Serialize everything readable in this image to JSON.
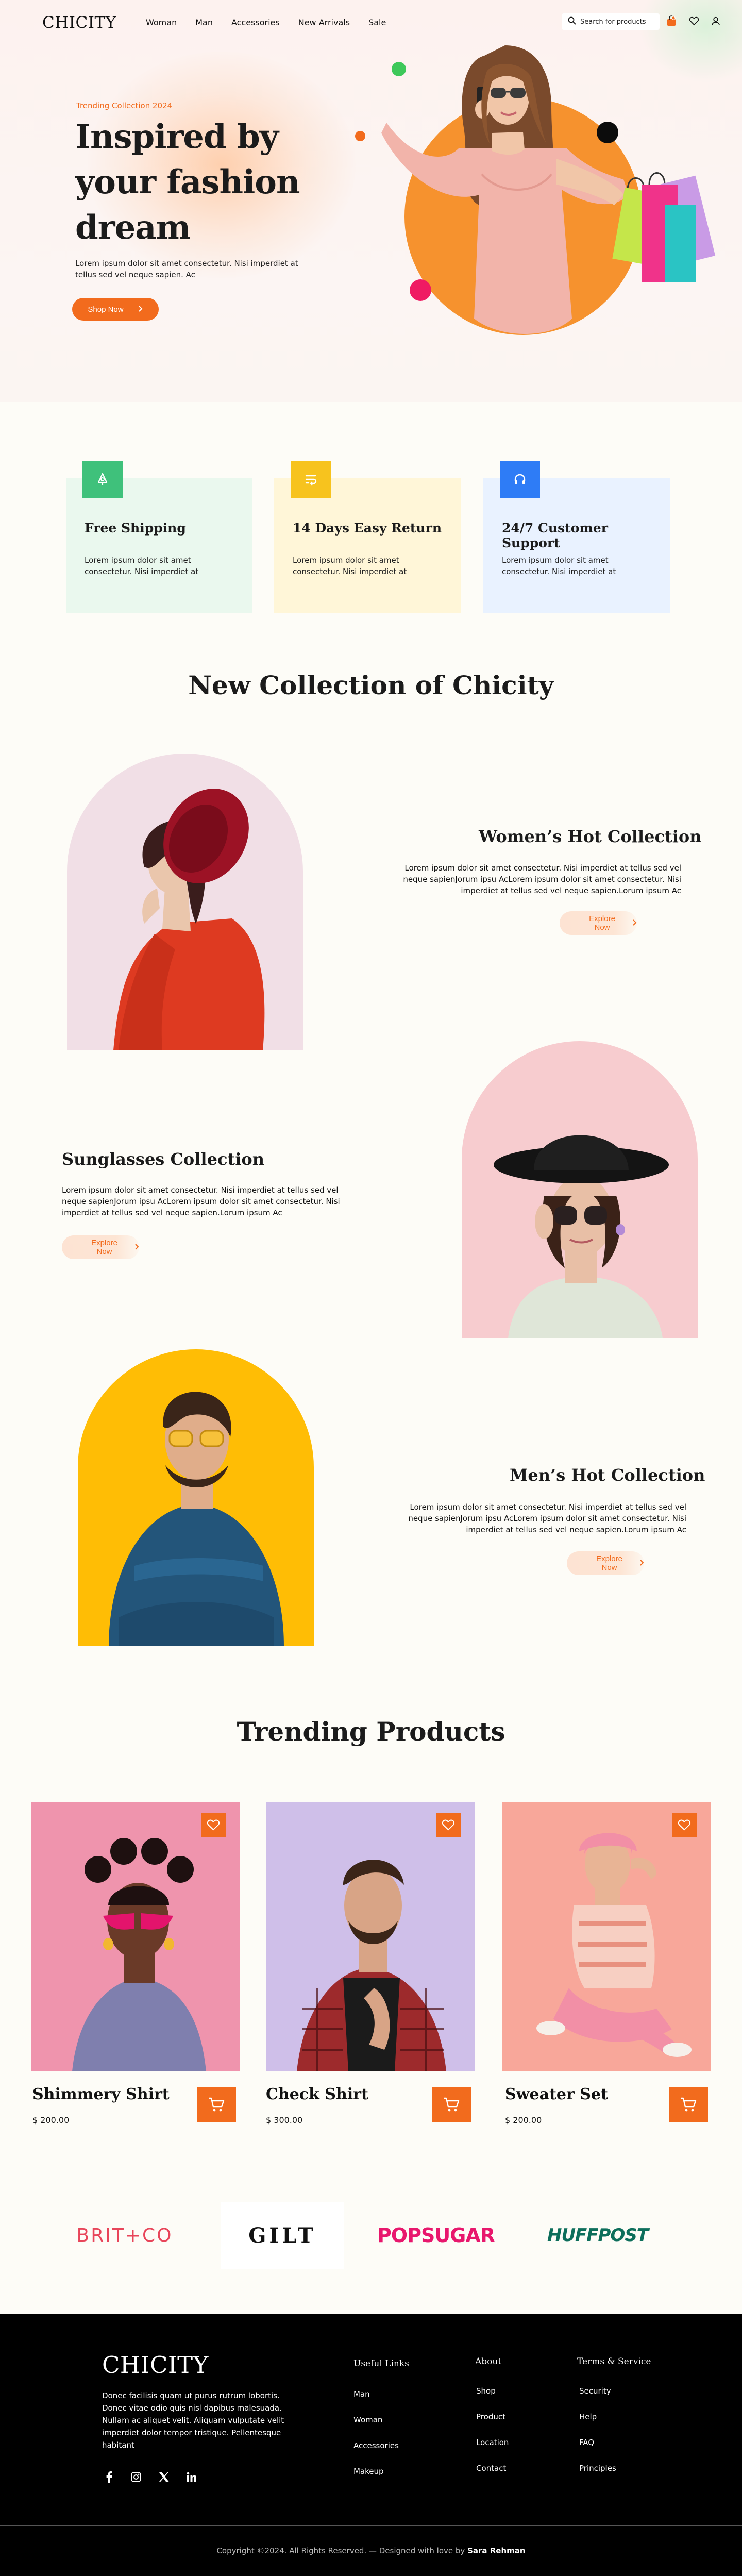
{
  "header": {
    "logo": "CHICITY",
    "nav": [
      "Woman",
      "Man",
      "Accessories",
      "New Arrivals",
      "Sale"
    ],
    "search_placeholder": "Search for products",
    "icons": [
      "search-icon",
      "bag-icon",
      "heart-icon",
      "user-icon"
    ]
  },
  "hero": {
    "kicker": "Trending Collection 2024",
    "title": "Inspired by your fashion dream",
    "description": "Lorem ipsum dolor sit amet consectetur. Nisi imperdiet at tellus sed vel neque sapien. Ac",
    "cta": "Shop Now"
  },
  "features": [
    {
      "title": "Free Shipping",
      "desc": "Lorem ipsum dolor sit amet consectetur. Nisi imperdiet at",
      "icon": "truck-icon",
      "color": "#3fc17b",
      "bg": "#eaf8ee"
    },
    {
      "title": "14 Days Easy Return",
      "desc": "Lorem ipsum dolor sit amet consectetur. Nisi imperdiet at",
      "icon": "return-icon",
      "color": "#f7c31e",
      "bg": "#fff6d8"
    },
    {
      "title": "24/7 Customer Support",
      "desc": "Lorem ipsum dolor sit amet consectetur. Nisi imperdiet at",
      "icon": "headphones-icon",
      "color": "#2e7cf6",
      "bg": "#e9f2ff"
    }
  ],
  "collections": {
    "title": "New Collection of Chicity",
    "items": [
      {
        "title": "Women’s Hot Collection",
        "desc": "Lorem ipsum dolor sit amet consectetur. Nisi imperdiet at tellus sed vel neque sapienJorum ipsu AcLorem ipsum dolor sit amet consectetur. Nisi imperdiet at tellus sed vel neque sapien.Lorum ipsum Ac",
        "cta": "Explore Now"
      },
      {
        "title": "Sunglasses Collection",
        "desc": "Lorem ipsum dolor sit amet consectetur. Nisi imperdiet at tellus sed vel neque sapienJorum ipsu AcLorem ipsum dolor sit amet consectetur. Nisi imperdiet at tellus sed vel neque sapien.Lorum ipsum Ac",
        "cta": "Explore Now"
      },
      {
        "title": "Men’s Hot Collection",
        "desc": "Lorem ipsum dolor sit amet consectetur. Nisi imperdiet at tellus sed vel neque sapienJorum ipsu AcLorem ipsum dolor sit amet consectetur. Nisi imperdiet at tellus sed vel neque sapien.Lorum ipsum Ac",
        "cta": "Explore Now"
      }
    ]
  },
  "trending": {
    "title": "Trending Products",
    "products": [
      {
        "name": "Shimmery Shirt",
        "price": "$ 200.00"
      },
      {
        "name": "Check  Shirt",
        "price": "$ 300.00"
      },
      {
        "name": "Sweater Set",
        "price": "$ 200.00"
      }
    ]
  },
  "brands": [
    "BRIT+CO",
    "GILT",
    "POPSUGAR",
    "HUFFPOST"
  ],
  "footer": {
    "logo": "CHICITY",
    "about": "Donec facilisis quam ut purus rutrum lobortis. Donec vitae odio quis nisl dapibus malesuada. Nullam ac aliquet velit. Aliquam vulputate velit imperdiet dolor tempor tristique. Pellentesque habitant",
    "social": [
      "facebook-icon",
      "instagram-icon",
      "x-icon",
      "linkedin-icon"
    ],
    "columns": [
      {
        "title": "Useful Links",
        "links": [
          "Man",
          "Woman",
          "Accessories",
          "Makeup"
        ]
      },
      {
        "title": "About",
        "links": [
          "Shop",
          "Product",
          "Location",
          "Contact"
        ]
      },
      {
        "title": "Terms & Service",
        "links": [
          "Security",
          "Help",
          "FAQ",
          "Principles"
        ]
      }
    ],
    "copyright": "Copyright ©2024. All Rights Reserved. — Designed with love by",
    "designer": "Sara Rehman"
  },
  "colors": {
    "accent": "#f26b1d",
    "hero_circle": "#f6922e",
    "background": "#fdfcf7"
  }
}
